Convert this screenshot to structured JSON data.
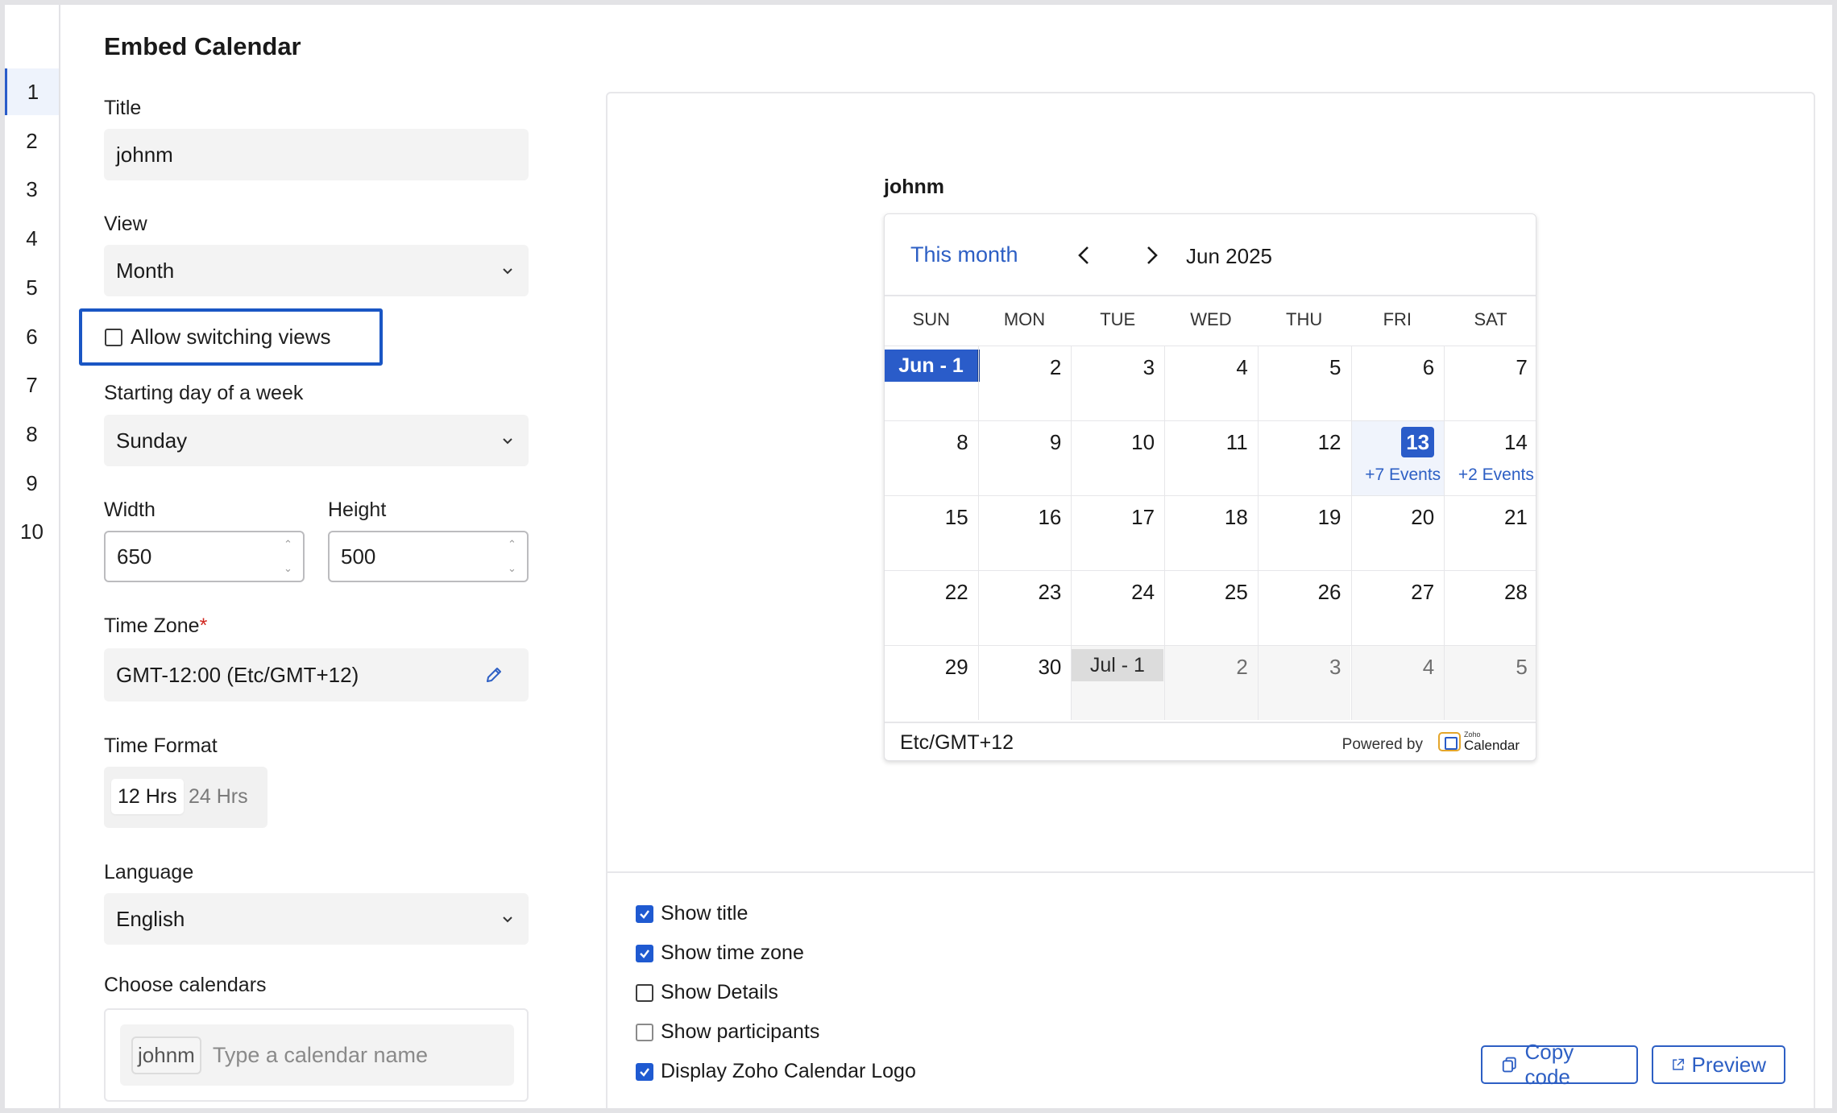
{
  "panel": {
    "title": "Embed Calendar",
    "title_label": "Title",
    "title_value": "johnm",
    "view_label": "View",
    "view_value": "Month",
    "allow_switching": "Allow switching views",
    "start_day_label": "Starting day of a week",
    "start_day_value": "Sunday",
    "width_label": "Width",
    "width_value": "650",
    "height_label": "Height",
    "height_value": "500",
    "timezone_label": "Time Zone",
    "timezone_required": "*",
    "timezone_value": "GMT-12:00 (Etc/GMT+12)",
    "time_format_label": "Time Format",
    "time_format_options": [
      "12 Hrs",
      "24 Hrs"
    ],
    "time_format_selected": "12 Hrs",
    "language_label": "Language",
    "language_value": "English",
    "choose_label": "Choose calendars",
    "choose_chip": "johnm",
    "choose_placeholder": "Type a calendar name"
  },
  "steps": [
    "1",
    "2",
    "3",
    "4",
    "5",
    "6",
    "7",
    "8",
    "9",
    "10"
  ],
  "calendar": {
    "title": "johnm",
    "this_month": "This month",
    "month_label": "Jun 2025",
    "weekdays": [
      "SUN",
      "MON",
      "TUE",
      "WED",
      "THU",
      "FRI",
      "SAT"
    ],
    "first_day_label": "Jun - 1",
    "next_first_label": "Jul - 1",
    "today": "13",
    "events_fri": "+7 Events",
    "events_sat": "+2 Events",
    "timezone_footer": "Etc/GMT+12",
    "powered_by": "Powered by",
    "logo_small": "Zoho",
    "logo_big": "Calendar"
  },
  "options": {
    "show_title": "Show title",
    "show_timezone": "Show time zone",
    "show_details": "Show Details",
    "show_participants": "Show participants",
    "display_logo": "Display Zoho Calendar Logo"
  },
  "buttons": {
    "copy_code": "Copy code",
    "preview": "Preview"
  },
  "colors": {
    "accent": "#2a5cc9",
    "highlight_border": "#1a56c4"
  }
}
